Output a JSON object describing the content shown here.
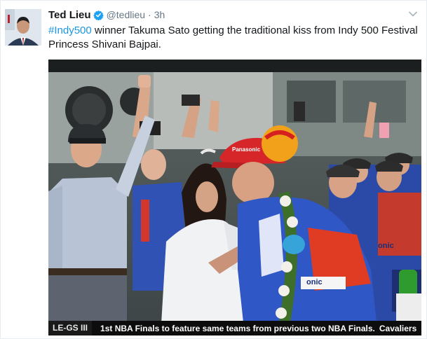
{
  "tweet": {
    "author": {
      "display_name": "Ted Lieu",
      "handle": "@tedlieu",
      "verified": true,
      "avatar_icon": "profile-photo"
    },
    "time": "3h",
    "separator": "·",
    "text": {
      "hashtag": "#Indy500",
      "line1_rest": " winner Takuma Sato getting the traditional kiss from Indy 500 Festival",
      "line2": "Princess Shivani Bajpai."
    },
    "caret_icon": "chevron-down-icon"
  },
  "media": {
    "ticker": {
      "left": "LE-GS III",
      "headline": "1st NBA Finals to feature same teams from previous two NBA Finals.",
      "right": "Cavaliers"
    },
    "overlay_labels": {
      "helmet_text": "Panasonic",
      "jacket_text": "onic",
      "suit_text": "onic"
    }
  },
  "colors": {
    "link": "#1b95e0",
    "verified": "#1da1f2",
    "muted": "#657786",
    "text": "#14171a"
  }
}
